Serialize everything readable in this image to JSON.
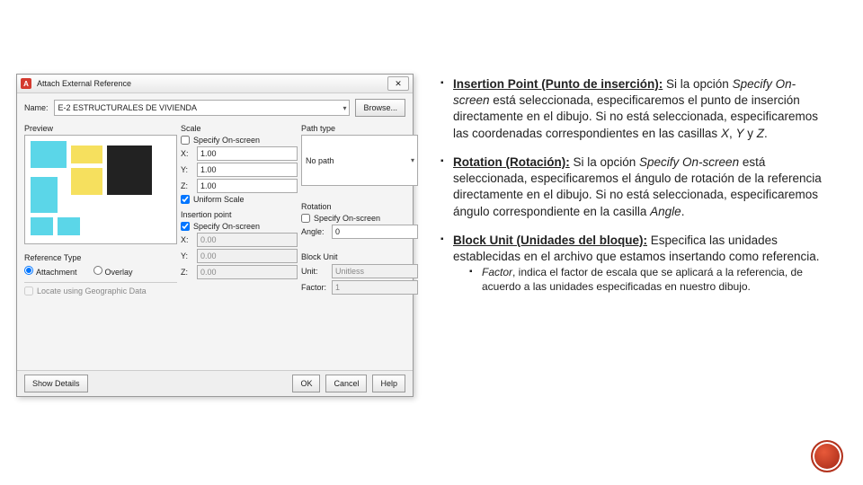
{
  "dialog": {
    "title": "Attach External Reference",
    "name_label": "Name:",
    "name_value": "E-2 ESTRUCTURALES DE VIVIENDA",
    "browse": "Browse...",
    "preview_label": "Preview",
    "scale": {
      "label": "Scale",
      "specify": "Specify On-screen",
      "x": "1.00",
      "y": "1.00",
      "z": "1.00",
      "uniform": "Uniform Scale"
    },
    "insertion": {
      "label": "Insertion point",
      "specify": "Specify On-screen",
      "x": "0.00",
      "y": "0.00",
      "z": "0.00"
    },
    "path": {
      "label": "Path type",
      "value": "No path"
    },
    "rotation": {
      "label": "Rotation",
      "specify": "Specify On-screen",
      "angle_label": "Angle:",
      "angle": "0"
    },
    "block_unit": {
      "label": "Block Unit",
      "unit_label": "Unit:",
      "unit": "Unitless",
      "factor_label": "Factor:",
      "factor": "1"
    },
    "ref_type": {
      "label": "Reference Type",
      "attachment": "Attachment",
      "overlay": "Overlay"
    },
    "geo": "Locate using Geographic Data",
    "buttons": {
      "show_details": "Show Details",
      "ok": "OK",
      "cancel": "Cancel",
      "help": "Help"
    }
  },
  "text": {
    "p1_title": "Insertion Point (Punto de inserción):",
    "p1_body": " Si la opción ",
    "p1_i": "Specify On-screen",
    "p1_body2": " está seleccionada, especificaremos el punto de inserción directamente en el dibujo. Si no está seleccionada, especificaremos las coordenadas correspondientes en las casillas ",
    "p1_i2": "X",
    "p1_body3": ", ",
    "p1_i3": "Y",
    "p1_body4": " y ",
    "p1_i4": "Z",
    "p1_body5": ".",
    "p2_title": "Rotation (Rotación):",
    "p2_body": " Si la opción ",
    "p2_i": "Specify On-screen",
    "p2_body2": " está seleccionada, especificaremos el ángulo de rotación de la referencia directamente en el dibujo. Si no está seleccionada, especificaremos ángulo correspondiente en la casilla ",
    "p2_i2": "Angle",
    "p2_body3": ".",
    "p3_title": "Block Unit (Unidades del bloque):",
    "p3_body": " Especifica las unidades establecidas en el archivo que estamos insertando como referencia.",
    "p3s_i": "Factor",
    "p3s_body": ", indica el factor de escala que se aplicará a la referencia, de acuerdo a las unidades especificadas en nuestro dibujo."
  }
}
